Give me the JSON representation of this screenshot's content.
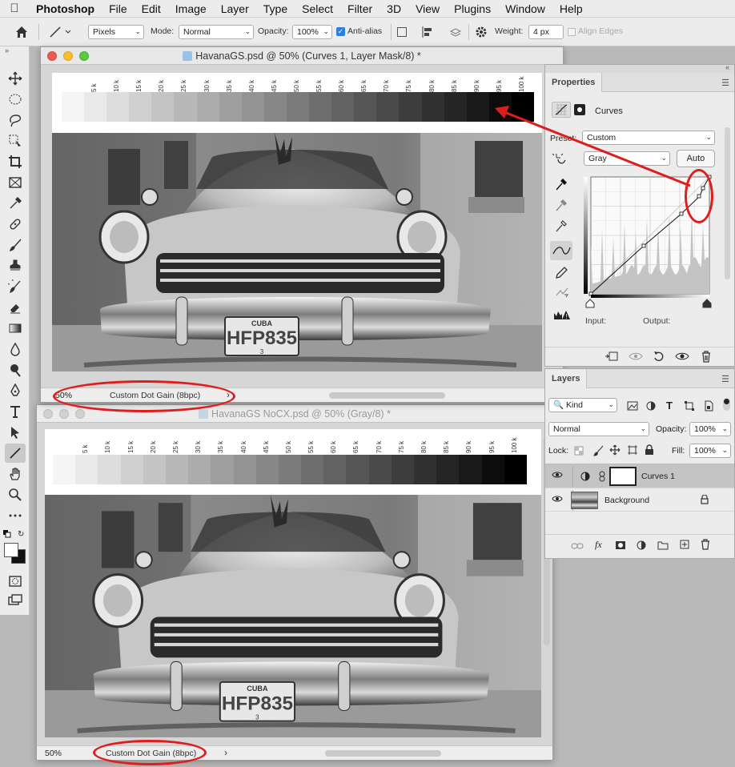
{
  "app": {
    "name": "Photoshop",
    "menus": [
      "File",
      "Edit",
      "Image",
      "Layer",
      "Type",
      "Select",
      "Filter",
      "3D",
      "View",
      "Plugins",
      "Window",
      "Help"
    ]
  },
  "options_bar": {
    "mode_unit": "Pixels",
    "mode_label": "Mode:",
    "mode_value": "Normal",
    "opacity_label": "Opacity:",
    "opacity_value": "100%",
    "antialias_label": "Anti-alias",
    "weight_label": "Weight:",
    "weight_value": "4 px",
    "align_edges_label": "Align Edges"
  },
  "doc1": {
    "title": "HavanaGS.psd @ 50% (Curves 1, Layer Mask/8) *",
    "zoom": "50%",
    "profile": "Custom Dot Gain (8bpc)",
    "plate": "HFP835",
    "plate_top": "CUBA",
    "plate_sub": "3"
  },
  "doc2": {
    "title": "HavanaGS NoCX.psd @ 50% (Gray/8) *",
    "zoom": "50%",
    "profile": "Custom Dot Gain (8bpc)",
    "plate": "HFP835",
    "plate_top": "CUBA",
    "plate_sub": "3"
  },
  "step_labels": [
    "5 k",
    "10 k",
    "15 k",
    "20 k",
    "25 k",
    "30 k",
    "35 k",
    "40 k",
    "45 k",
    "50 k",
    "55 k",
    "60 k",
    "65 k",
    "70 k",
    "75 k",
    "80 k",
    "85 k",
    "90 k",
    "95 k",
    "100 k"
  ],
  "properties": {
    "tab": "Properties",
    "adjustment": "Curves",
    "preset_label": "Preset:",
    "preset_value": "Custom",
    "channel_value": "Gray",
    "auto_label": "Auto",
    "input_label": "Input:",
    "output_label": "Output:"
  },
  "layers": {
    "tab": "Layers",
    "kind": "Kind",
    "blend": "Normal",
    "opacity_label": "Opacity:",
    "opacity_value": "100%",
    "lock_label": "Lock:",
    "fill_label": "Fill:",
    "fill_value": "100%",
    "items": [
      {
        "name": "Curves 1"
      },
      {
        "name": "Background"
      }
    ]
  },
  "colors": {
    "annotation": "#e01d1d",
    "panel": "#ececec"
  }
}
